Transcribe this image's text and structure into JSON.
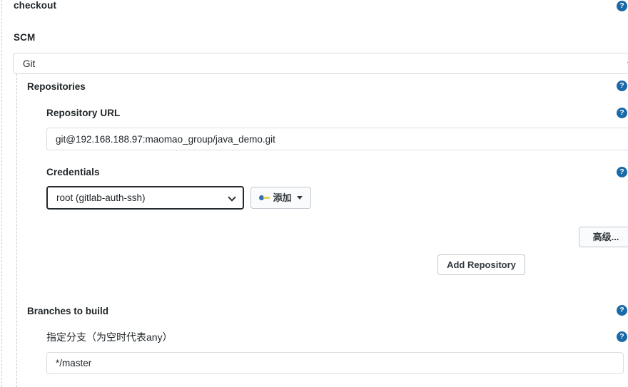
{
  "page": {
    "title": "checkout"
  },
  "scm": {
    "section_label": "SCM",
    "selected": "Git",
    "chevron_icon": "chevron-down-icon"
  },
  "repositories": {
    "section_label": "Repositories",
    "repository_url": {
      "label": "Repository URL",
      "value": "git@192.168.188.97:maomao_group/java_demo.git",
      "placeholder": ""
    },
    "credentials": {
      "label": "Credentials",
      "selected": "root (gitlab-auth-ssh)",
      "add_button": {
        "label": "添加",
        "icon": "key-icon",
        "caret_icon": "caret-down-icon"
      }
    },
    "advanced_button": {
      "label": "高级..."
    },
    "add_repository_button": {
      "label": "Add Repository"
    }
  },
  "branches": {
    "section_label": "Branches to build",
    "branch_spec": {
      "label": "指定分支（为空时代表any）",
      "value": "*/master",
      "placeholder": ""
    }
  },
  "help": {
    "glyph": "?",
    "icon_name": "help-icon",
    "color": "#1a6aa8"
  },
  "colors": {
    "help_blue": "#1a6aa8",
    "text": "#1f2428",
    "input_border": "#d9dde1",
    "focus_border": "#24292e",
    "button_bg": "#fafbfc",
    "rail_dash": "#c9cccf"
  }
}
